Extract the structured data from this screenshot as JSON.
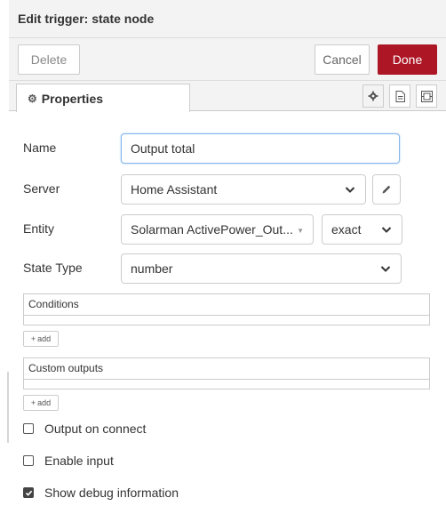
{
  "dialog": {
    "title": "Edit trigger: state node",
    "delete_label": "Delete",
    "cancel_label": "Cancel",
    "done_label": "Done"
  },
  "tabs": {
    "properties_label": "Properties",
    "icons": [
      "gear-icon",
      "document-icon",
      "layout-icon"
    ]
  },
  "form": {
    "name": {
      "label": "Name",
      "value": "Output total"
    },
    "server": {
      "label": "Server",
      "value": "Home Assistant"
    },
    "entity": {
      "label": "Entity",
      "value": "Solarman ActivePower_Out...",
      "match": "exact"
    },
    "state_type": {
      "label": "State Type",
      "value": "number"
    },
    "conditions": {
      "label": "Conditions",
      "add_label": "add"
    },
    "custom_outputs": {
      "label": "Custom outputs",
      "add_label": "add"
    },
    "checkboxes": [
      {
        "label": "Output on connect",
        "checked": false
      },
      {
        "label": "Enable input",
        "checked": false
      },
      {
        "label": "Show debug information",
        "checked": true
      }
    ]
  },
  "colors": {
    "done_button": "#ad1625",
    "focus_border": "#85b6e9"
  }
}
